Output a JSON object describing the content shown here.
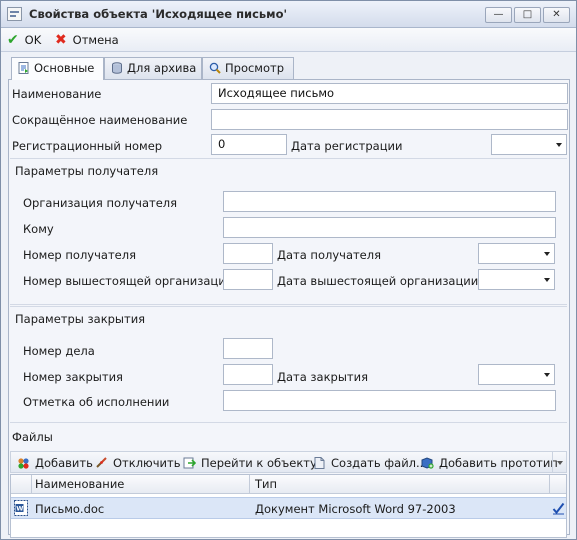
{
  "window": {
    "title": "Свойства объекта 'Исходящее письмо'",
    "minimize": "—",
    "maximize": "□",
    "close": "✕"
  },
  "toolbar": {
    "ok_label": "OK",
    "cancel_label": "Отмена"
  },
  "tabs": [
    {
      "label": "Основные",
      "icon": "document-icon",
      "active": true
    },
    {
      "label": "Для архива",
      "icon": "database-icon",
      "active": false
    },
    {
      "label": "Просмотр",
      "icon": "magnifier-icon",
      "active": false
    }
  ],
  "main": {
    "name_label": "Наименование",
    "name_value": "Исходящее письмо",
    "short_name_label": "Сокращённое наименование",
    "short_name_value": "",
    "reg_number_label": "Регистрационный номер",
    "reg_number_value": "0",
    "reg_date_label": "Дата регистрации",
    "reg_date_value": ""
  },
  "recipient": {
    "section_title": "Параметры получателя",
    "org_label": "Организация получателя",
    "org_value": "",
    "to_label": "Кому",
    "to_value": "",
    "number_label": "Номер получателя",
    "number_value": "",
    "date_label": "Дата получателя",
    "date_value": "",
    "parent_number_label": "Номер вышестоящей организации",
    "parent_number_value": "",
    "parent_date_label": "Дата вышестоящей организации",
    "parent_date_value": ""
  },
  "closing": {
    "section_title": "Параметры закрытия",
    "case_number_label": "Номер дела",
    "case_number_value": "",
    "close_number_label": "Номер закрытия",
    "close_number_value": "",
    "close_date_label": "Дата закрытия",
    "close_date_value": "",
    "execution_note_label": "Отметка об исполнении",
    "execution_note_value": ""
  },
  "files": {
    "section_title": "Файлы",
    "buttons": {
      "add": "Добавить",
      "detach": "Отключить",
      "goto": "Перейти к объекту",
      "create": "Создать файл...",
      "add_prototype": "Добавить прототип"
    },
    "columns": [
      "Наименование",
      "Тип"
    ],
    "rows": [
      {
        "name": "Письмо.doc",
        "type": "Документ Microsoft Word 97-2003",
        "checked": true
      }
    ]
  },
  "colors": {
    "accent": "#3a6fc4",
    "ok_green": "#2da52d",
    "cancel_red": "#e02a1e",
    "selected_row": "#dbe6f7"
  }
}
